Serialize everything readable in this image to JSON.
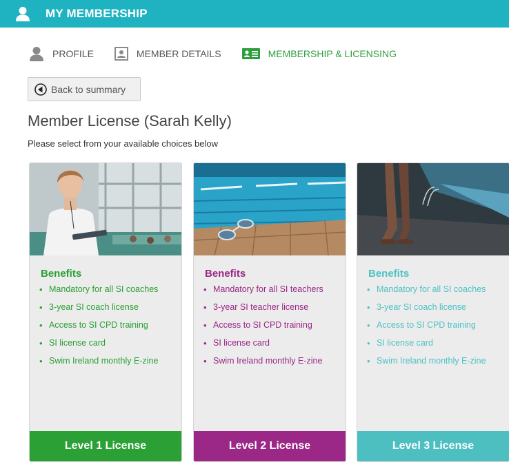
{
  "header": {
    "title": "MY MEMBERSHIP",
    "icon": "person-icon"
  },
  "tabs": [
    {
      "label": "PROFILE",
      "icon": "person-icon",
      "active": false
    },
    {
      "label": "MEMBER DETAILS",
      "icon": "id-photo-icon",
      "active": false
    },
    {
      "label": "MEMBERSHIP & LICENSING",
      "icon": "id-card-icon",
      "active": true
    }
  ],
  "back_button": {
    "label": "Back to summary",
    "icon": "back-arrow-icon"
  },
  "page_title": "Member License (Sarah Kelly)",
  "subtitle": "Please select from your available choices below",
  "colors": {
    "header": "#1fb3c2",
    "level1": "#2aa035",
    "level2": "#9b2787",
    "level3": "#4ebfc1"
  },
  "cards": [
    {
      "benefits_title": "Benefits",
      "benefits": [
        "Mandatory for all SI coaches",
        "3-year SI coach license",
        "Access to SI CPD training",
        "SI license card",
        "Swim Ireland monthly E-zine"
      ],
      "button_label": "Level 1 License"
    },
    {
      "benefits_title": "Benefits",
      "benefits": [
        "Mandatory for all SI teachers",
        "3-year SI teacher license",
        "Access to SI CPD training",
        "SI license card",
        "Swim Ireland monthly E-zine"
      ],
      "button_label": "Level 2 License"
    },
    {
      "benefits_title": "Benefits",
      "benefits": [
        "Mandatory for all SI coaches",
        "3-year SI coach license",
        "Access to SI CPD training",
        "SI license card",
        "Swim Ireland monthly E-zine"
      ],
      "button_label": "Level 3 License"
    }
  ]
}
